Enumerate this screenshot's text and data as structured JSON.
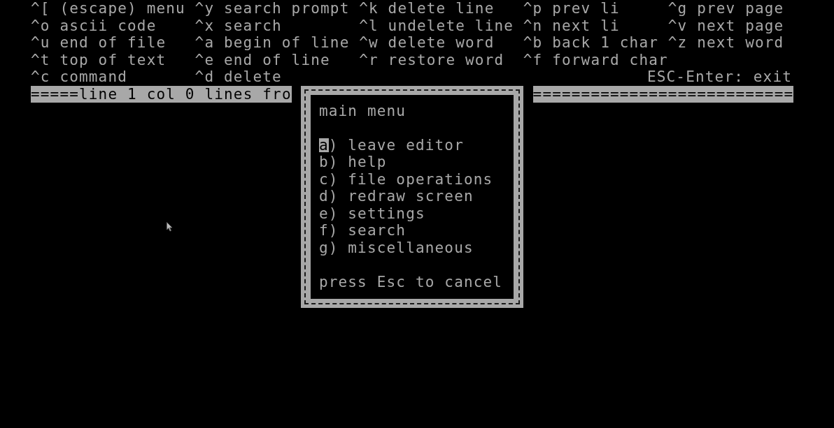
{
  "help_rows": [
    [
      "^[ (escape) menu",
      "^y search prompt",
      "^k delete line",
      "^p prev li",
      "^g prev page"
    ],
    [
      "^o ascii code",
      "^x search",
      "^l undelete line",
      "^n next li",
      "^v next page"
    ],
    [
      "^u end of file",
      "^a begin of line",
      "^w delete word",
      "^b back 1 char",
      "^z next word"
    ],
    [
      "^t top of text",
      "^e end of line",
      "^r restore word",
      "^f forward char"
    ],
    [
      "^c command",
      "^d delete"
    ]
  ],
  "exit_hint": "ESC-Enter: exit",
  "status_bar": {
    "left": "=====line 1 col 0 lines fro",
    "right": "==========================="
  },
  "menu": {
    "title": "main menu",
    "items": [
      {
        "label": "a) leave editor",
        "selected": true
      },
      {
        "label": "b) help",
        "selected": false
      },
      {
        "label": "c) file operations",
        "selected": false
      },
      {
        "label": "d) redraw screen",
        "selected": false
      },
      {
        "label": "e) settings",
        "selected": false
      },
      {
        "label": "f) search",
        "selected": false
      },
      {
        "label": "g) miscellaneous",
        "selected": false
      }
    ],
    "footer": "press Esc to cancel"
  }
}
